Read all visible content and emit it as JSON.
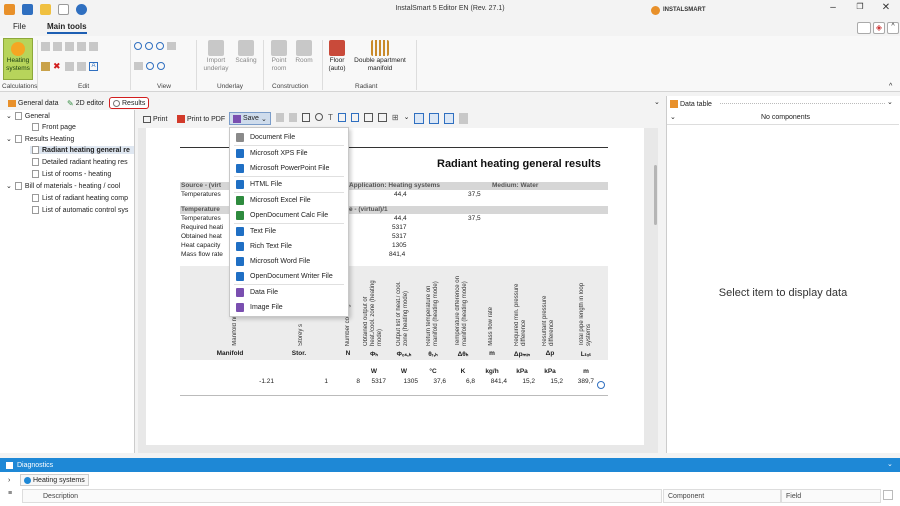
{
  "app": {
    "title": "InstalSmart 5 Editor EN (Rev. 27.1)",
    "brand": "INSTALSMART"
  },
  "menu": {
    "file": "File",
    "main_tools": "Main tools"
  },
  "ribbon": {
    "heating_systems": "Heating systems",
    "import_underlay": "Import underlay",
    "scaling": "Scaling",
    "point_room": "Point room",
    "room": "Room",
    "floor_auto": "Floor (auto)",
    "double_apartment_manifold": "Double apartment manifold",
    "groups": {
      "calculations": "Calculations",
      "edit": "Edit",
      "view": "View",
      "underlay": "Underlay",
      "construction": "Construction",
      "radiant": "Radiant"
    }
  },
  "tabs": {
    "general_data": "General data",
    "editor_2d": "2D editor",
    "results": "Results"
  },
  "tree": {
    "general": "General",
    "front_page": "Front page",
    "results_heating": "Results Heating",
    "radiant_general": "Radiant heating general re",
    "detailed_radiant": "Detailed radiant heating res",
    "list_rooms": "List of rooms - heating",
    "bom": "Bill of materials - heating / cool",
    "list_radiant": "List of radiant heating comp",
    "list_auto": "List of automatic control sys"
  },
  "toolbar": {
    "print": "Print",
    "print_pdf": "Print to PDF",
    "save": "Save"
  },
  "save_menu": [
    {
      "label": "Document File",
      "color": "#8a8a8a"
    },
    {
      "label": "Microsoft XPS File",
      "color": "#1f6fc4"
    },
    {
      "label": "Microsoft PowerPoint File",
      "color": "#1f6fc4"
    },
    {
      "label": "HTML File",
      "color": "#1f6fc4"
    },
    {
      "label": "Microsoft Excel File",
      "color": "#2e8b3e"
    },
    {
      "label": "OpenDocument Calc File",
      "color": "#2e8b3e"
    },
    {
      "label": "Text File",
      "color": "#1f6fc4"
    },
    {
      "label": "Rich Text File",
      "color": "#1f6fc4"
    },
    {
      "label": "Microsoft Word File",
      "color": "#1f6fc4"
    },
    {
      "label": "OpenDocument Writer File",
      "color": "#1f6fc4"
    },
    {
      "label": "Data File",
      "color": "#7a4fb0"
    },
    {
      "label": "Image File",
      "color": "#7a4fb0"
    }
  ],
  "report": {
    "title": "Radiant heating general results",
    "source": "Source - (virt",
    "application": "Application: Heating systems",
    "medium": "Medium: Water",
    "temperatures1": "Temperatures",
    "t1_val1": "44,4",
    "t1_val2": "37,5",
    "temperature_hdr": "Temperature",
    "temperature_hdr2": "e - (virtual)/1",
    "rows": [
      {
        "label": "Temperatures",
        "val": "44,4",
        "val2": "37,5"
      },
      {
        "label": "Required heati",
        "val": "5317",
        "val2": ""
      },
      {
        "label": "Obtained heat",
        "val": "5317",
        "val2": ""
      },
      {
        "label": "Heat capacity",
        "val": "1305",
        "val2": ""
      },
      {
        "label": "Mass flow rate",
        "val": "841,4",
        "val2": ""
      }
    ],
    "col_headers": [
      "Manifold number",
      "Storey s",
      "Number cooling circuits",
      "Obtained output of heat./cool. zone (heating mode)",
      "Output list of heat./ cool. zone (heating mode)",
      "Return temperature on manifold (heating mode)",
      "Temperature difference on manifold (heating mode)",
      "Mass flow rate",
      "Required min. pressure difference",
      "Resultant pressure difference",
      "Total pipe length in loop systems"
    ],
    "symbols": [
      "Manifold",
      "Stor.",
      "N",
      "Φₕ",
      "Φₒₛ,ₕ",
      "θᵣ,ₕ",
      "Δθₕ",
      "m",
      "Δpₘᵢₙ",
      "Δp",
      "Lₜₒₜ"
    ],
    "units": [
      "",
      "",
      "",
      "W",
      "W",
      "°C",
      "K",
      "kg/h",
      "kPa",
      "kPa",
      "m"
    ],
    "values": [
      "-1.21",
      "1",
      "8",
      "5317",
      "1305",
      "37,6",
      "6,8",
      "841,4",
      "15,2",
      "15,2",
      "389,7"
    ]
  },
  "right_panel": {
    "title": "Data table",
    "no_components": "No components",
    "placeholder": "Select item to display data"
  },
  "diagnostics": {
    "title": "Diagnostics",
    "heating_systems": "Heating systems",
    "description": "Description",
    "component": "Component",
    "field": "Field"
  }
}
